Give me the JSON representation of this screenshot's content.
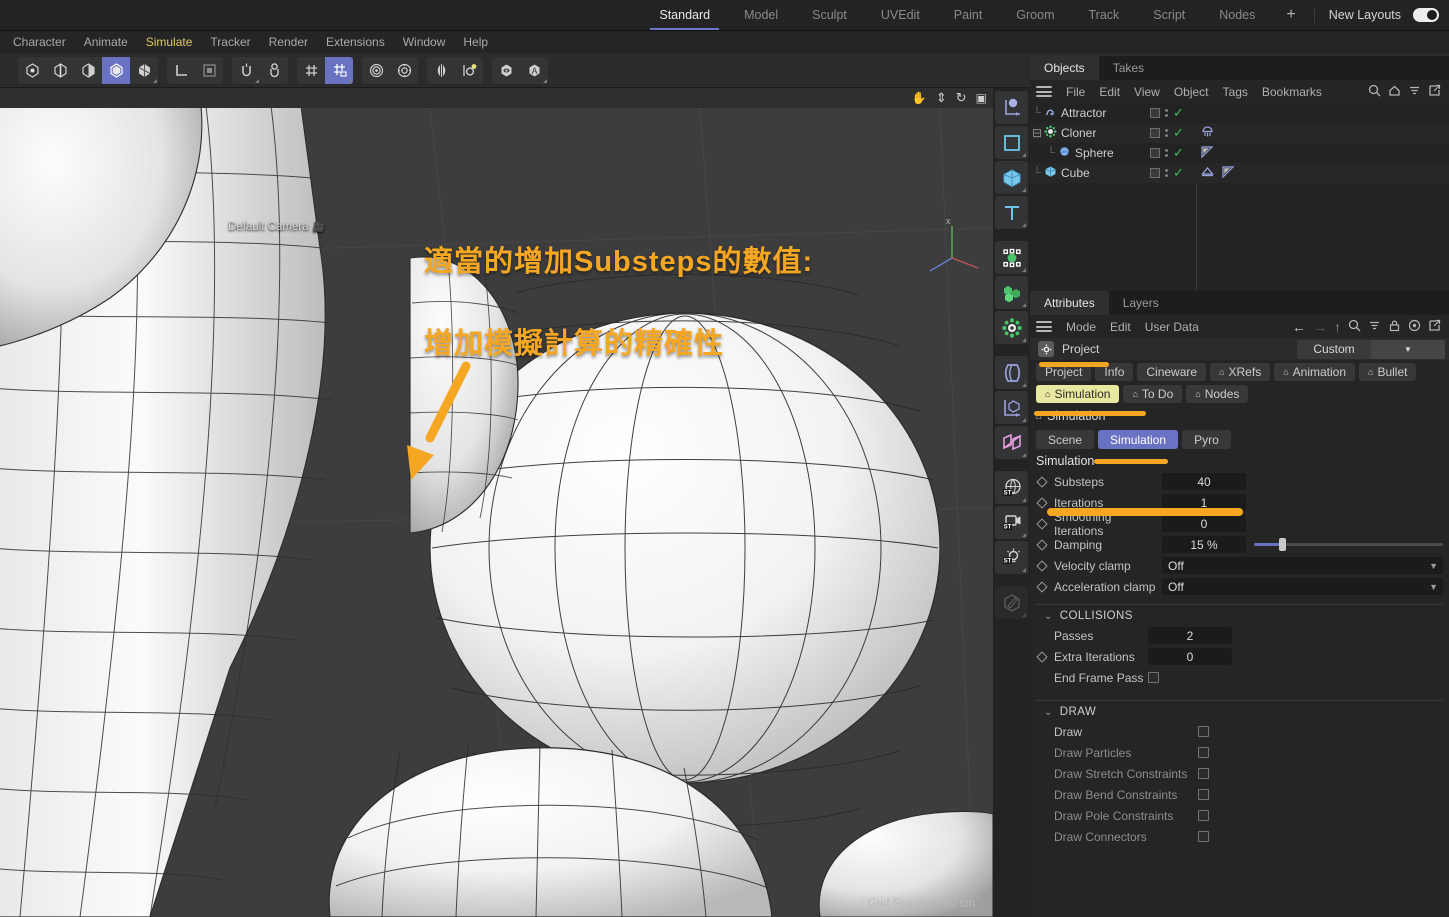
{
  "layout_bar": {
    "tabs": [
      {
        "label": "Standard",
        "active": true
      },
      {
        "label": "Model",
        "active": false
      },
      {
        "label": "Sculpt",
        "active": false
      },
      {
        "label": "UVEdit",
        "active": false
      },
      {
        "label": "Paint",
        "active": false
      },
      {
        "label": "Groom",
        "active": false
      },
      {
        "label": "Track",
        "active": false
      },
      {
        "label": "Script",
        "active": false
      },
      {
        "label": "Nodes",
        "active": false
      }
    ],
    "add_label": "+",
    "new_layouts_label": "New Layouts"
  },
  "menu_bar": {
    "items": [
      {
        "label": "Character",
        "highlight": false
      },
      {
        "label": "Animate",
        "highlight": false
      },
      {
        "label": "Simulate",
        "highlight": true
      },
      {
        "label": "Tracker",
        "highlight": false
      },
      {
        "label": "Render",
        "highlight": false
      },
      {
        "label": "Extensions",
        "highlight": false
      },
      {
        "label": "Window",
        "highlight": false
      },
      {
        "label": "Help",
        "highlight": false
      }
    ]
  },
  "toolbar": {
    "groups": [
      {
        "icons": [
          "point-mode-icon",
          "edge-mode-icon",
          "polygon-mode-icon",
          "model-mode-icon",
          "object-axis-icon"
        ],
        "selected_index": 3
      },
      {
        "icons": [
          "world-axis-icon",
          "frame-selection-icon"
        ],
        "selected_index": -1
      },
      {
        "icons": [
          "snap-icon",
          "snap-settings-icon"
        ],
        "selected_index": -1
      },
      {
        "icons": [
          "workplane-icon",
          "workplane-lock-icon"
        ],
        "selected_index": 1
      },
      {
        "icons": [
          "render-view-icon",
          "render-settings-icon"
        ],
        "selected_index": -1
      },
      {
        "icons": [
          "symmetry-icon",
          "modeling-settings-icon"
        ],
        "selected_index": -1
      },
      {
        "icons": [
          "visibility-icon",
          "annotation-icon"
        ],
        "selected_index": -1
      }
    ],
    "right_groups": [
      {
        "icons": [
          "render-frame-icon",
          "render-preview-icon",
          "render-settings2-icon"
        ],
        "selected_index": -1
      },
      {
        "icons": [
          "material-sphere-icon"
        ],
        "selected_index": -1
      }
    ]
  },
  "viewport": {
    "camera_label": "Default Camera",
    "header_icons": [
      "pan-icon",
      "dolly-icon",
      "rotate-icon",
      "maximize-icon"
    ],
    "annotation_line1": "適當的增加Substeps的數值:",
    "annotation_line2": "增加模擬計算的精確性",
    "annotation_color": "#f5a623",
    "grid_spacing": "Grid Spacing : 50 cm"
  },
  "rail": {
    "icons": [
      "null-object-icon",
      "spline-rect-icon",
      "cube-primitive-icon",
      "text-spline-icon",
      "deformer-group-icon",
      "array-generator-icon",
      "mograph-cloner-icon",
      "bend-deformer-icon",
      "axis-box-icon",
      "field-icon",
      "environment-icon",
      "stage-camera-icon",
      "light-icon",
      "sculpt-brush-icon"
    ]
  },
  "objects_panel": {
    "tabs": [
      {
        "label": "Objects",
        "active": true
      },
      {
        "label": "Takes",
        "active": false
      }
    ],
    "menu": [
      "File",
      "Edit",
      "View",
      "Object",
      "Tags",
      "Bookmarks"
    ],
    "menu_icons": [
      "search-icon",
      "home-icon",
      "filter-icon",
      "popout-icon"
    ],
    "rows": [
      {
        "name": "Attractor",
        "icon": "attractor-icon",
        "indent": 0,
        "expander": "",
        "visible": true,
        "tags": []
      },
      {
        "name": "Cloner",
        "icon": "cloner-icon",
        "indent": 0,
        "expander": "minus",
        "visible": true,
        "tags": [
          "simulation-tag"
        ]
      },
      {
        "name": "Sphere",
        "icon": "sphere-icon",
        "indent": 1,
        "expander": "",
        "visible": true,
        "tags": [
          "phong-tag"
        ]
      },
      {
        "name": "Cube",
        "icon": "cube-icon",
        "indent": 0,
        "expander": "",
        "visible": true,
        "tags": [
          "collider-tag",
          "phong-tag"
        ]
      }
    ]
  },
  "attributes_panel": {
    "tabs": [
      {
        "label": "Attributes",
        "active": true
      },
      {
        "label": "Layers",
        "active": false
      }
    ],
    "menu": [
      "Mode",
      "Edit",
      "User Data"
    ],
    "menu_icons": [
      "back-arrow-icon",
      "forward-arrow-icon",
      "up-arrow-icon",
      "search-icon",
      "filter-icon",
      "lock-icon",
      "target-icon",
      "popout-icon"
    ],
    "object_name": "Project",
    "object_icon": "project-settings-icon",
    "preset_dropdown": "Custom",
    "chips": [
      {
        "label": "Project",
        "active": false,
        "bell": false
      },
      {
        "label": "Info",
        "active": false,
        "bell": false
      },
      {
        "label": "Cineware",
        "active": false,
        "bell": false
      },
      {
        "label": "XRefs",
        "active": false,
        "bell": true
      },
      {
        "label": "Animation",
        "active": false,
        "bell": true
      },
      {
        "label": "Bullet",
        "active": false,
        "bell": true
      },
      {
        "label": "Simulation",
        "active": true,
        "bell": true
      },
      {
        "label": "To Do",
        "active": false,
        "bell": true
      },
      {
        "label": "Nodes",
        "active": false,
        "bell": true
      }
    ],
    "section_title": "Simulation",
    "subtabs": [
      {
        "label": "Scene",
        "active": false
      },
      {
        "label": "Simulation",
        "active": true
      },
      {
        "label": "Pyro",
        "active": false
      }
    ],
    "group_label": "Simulation",
    "fields": [
      {
        "label": "Substeps",
        "type": "number",
        "value": "40",
        "diamond": true
      },
      {
        "label": "Iterations",
        "type": "number",
        "value": "1",
        "diamond": true
      },
      {
        "label": "Smoothing Iterations",
        "type": "number",
        "value": "0",
        "diamond": true
      },
      {
        "label": "Damping",
        "type": "slider",
        "value": "15 %",
        "diamond": true,
        "percent": 15
      },
      {
        "label": "Velocity clamp",
        "type": "dropdown",
        "value": "Off",
        "diamond": true
      },
      {
        "label": "Acceleration clamp",
        "type": "dropdown",
        "value": "Off",
        "diamond": true
      }
    ],
    "collisions": {
      "title": "COLLISIONS",
      "fields": [
        {
          "label": "Passes",
          "type": "number",
          "value": "2",
          "diamond": false
        },
        {
          "label": "Extra Iterations",
          "type": "number",
          "value": "0",
          "diamond": true
        },
        {
          "label": "End Frame Pass",
          "type": "checkbox",
          "value": false,
          "diamond": false
        }
      ]
    },
    "draw": {
      "title": "DRAW",
      "fields": [
        {
          "label": "Draw",
          "type": "checkbox",
          "value": false,
          "dim": false
        },
        {
          "label": "Draw Particles",
          "type": "checkbox",
          "value": false,
          "dim": true
        },
        {
          "label": "Draw Stretch Constraints",
          "type": "checkbox",
          "value": false,
          "dim": true
        },
        {
          "label": "Draw Bend Constraints",
          "type": "checkbox",
          "value": false,
          "dim": true
        },
        {
          "label": "Draw Pole Constraints",
          "type": "checkbox",
          "value": false,
          "dim": true
        },
        {
          "label": "Draw Connectors",
          "type": "checkbox",
          "value": false,
          "dim": true
        }
      ]
    }
  }
}
